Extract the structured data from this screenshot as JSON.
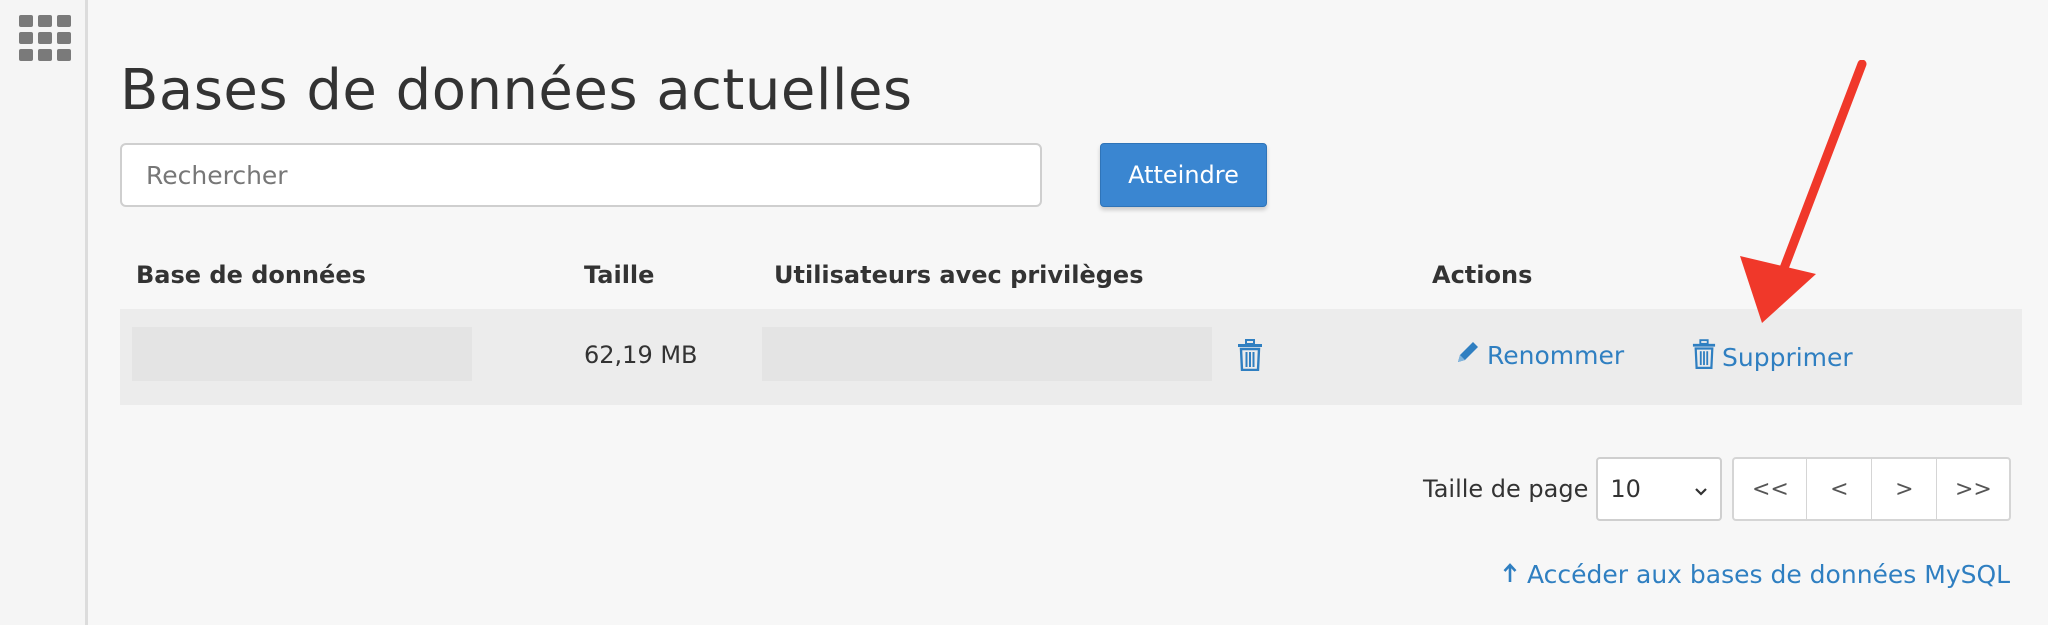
{
  "sidebar": {
    "apps_icon": "grid-icon"
  },
  "page": {
    "title": "Bases de données actuelles"
  },
  "search": {
    "placeholder": "Rechercher",
    "value": "",
    "button_label": "Atteindre"
  },
  "table": {
    "headers": {
      "database": "Base de données",
      "size": "Taille",
      "users": "Utilisateurs avec privilèges",
      "actions": "Actions"
    },
    "rows": [
      {
        "database": "",
        "size": "62,19 MB",
        "users": "",
        "rename_label": "Renommer",
        "delete_label": "Supprimer"
      }
    ]
  },
  "pagination": {
    "page_size_label": "Taille de page",
    "page_size_value": "10",
    "first": "<<",
    "prev": "<",
    "next": ">",
    "last": ">>"
  },
  "footer_link": {
    "label": "Accéder aux bases de données MySQL"
  },
  "colors": {
    "accent": "#3a86d1",
    "link": "#2f7fc1",
    "annotation": "#f0382a"
  }
}
